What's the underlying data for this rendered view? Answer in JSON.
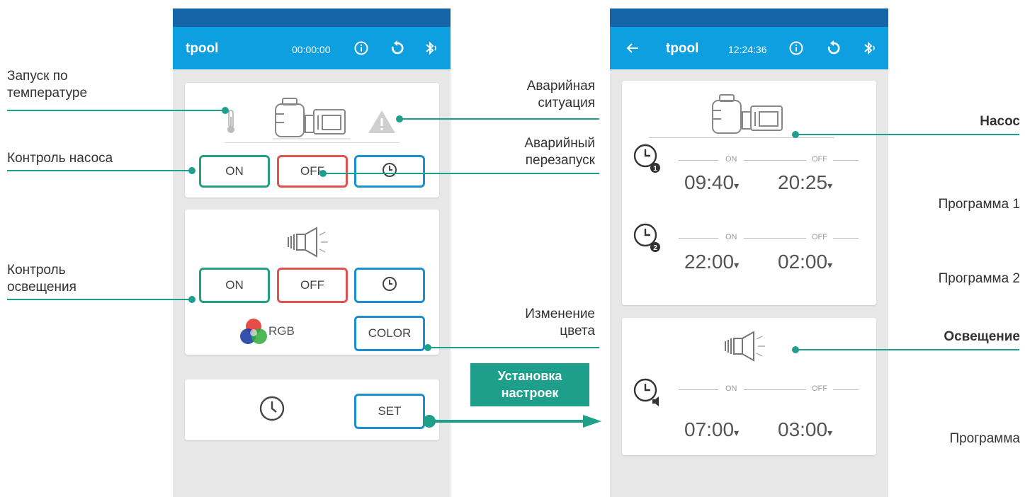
{
  "left_screen": {
    "app_title": "tpool",
    "timer": "00:00:00",
    "pump_card": {
      "on_label": "ON",
      "off_label": "OFF"
    },
    "light_card": {
      "on_label": "ON",
      "off_label": "OFF",
      "rgb_label": "RGB",
      "color_label": "COLOR"
    },
    "settings_card": {
      "set_label": "SET"
    }
  },
  "right_screen": {
    "app_title": "tpool",
    "clock": "12:24:36",
    "pump_schedule": {
      "program1": {
        "on_label": "ON",
        "off_label": "OFF",
        "on_time": "09:40",
        "off_time": "20:25",
        "badge": "1"
      },
      "program2": {
        "on_label": "ON",
        "off_label": "OFF",
        "on_time": "22:00",
        "off_time": "02:00",
        "badge": "2"
      }
    },
    "light_schedule": {
      "on_label": "ON",
      "off_label": "OFF",
      "on_time": "07:00",
      "off_time": "03:00"
    }
  },
  "annotations": {
    "temp_start": [
      "Запуск по",
      "температуре"
    ],
    "pump_control": "Контроль насоса",
    "light_control": [
      "Контроль",
      "освещения"
    ],
    "emergency": [
      "Аварийная",
      "ситуация"
    ],
    "emergency_restart": [
      "Аварийный",
      "перезапуск"
    ],
    "color_change": [
      "Изменение",
      "цвета"
    ],
    "apply_settings": [
      "Установка",
      "настроек"
    ],
    "pump": "Насос",
    "program1": "Программа 1",
    "program2": "Программа 2",
    "lighting": "Освещение",
    "program": "Программа"
  },
  "colors": {
    "accent": "#1d9f8b",
    "appbar": "#0d9fe0",
    "statusbar": "#1566a8",
    "on": "#23a07f",
    "off": "#e0524f",
    "timer": "#1b8fd0"
  },
  "icons": [
    "thermometer-icon",
    "pump-icon",
    "warning-icon",
    "clock-icon",
    "speaker-icon",
    "rgb-icon",
    "info-icon",
    "refresh-icon",
    "bluetooth-icon",
    "back-arrow-icon"
  ]
}
